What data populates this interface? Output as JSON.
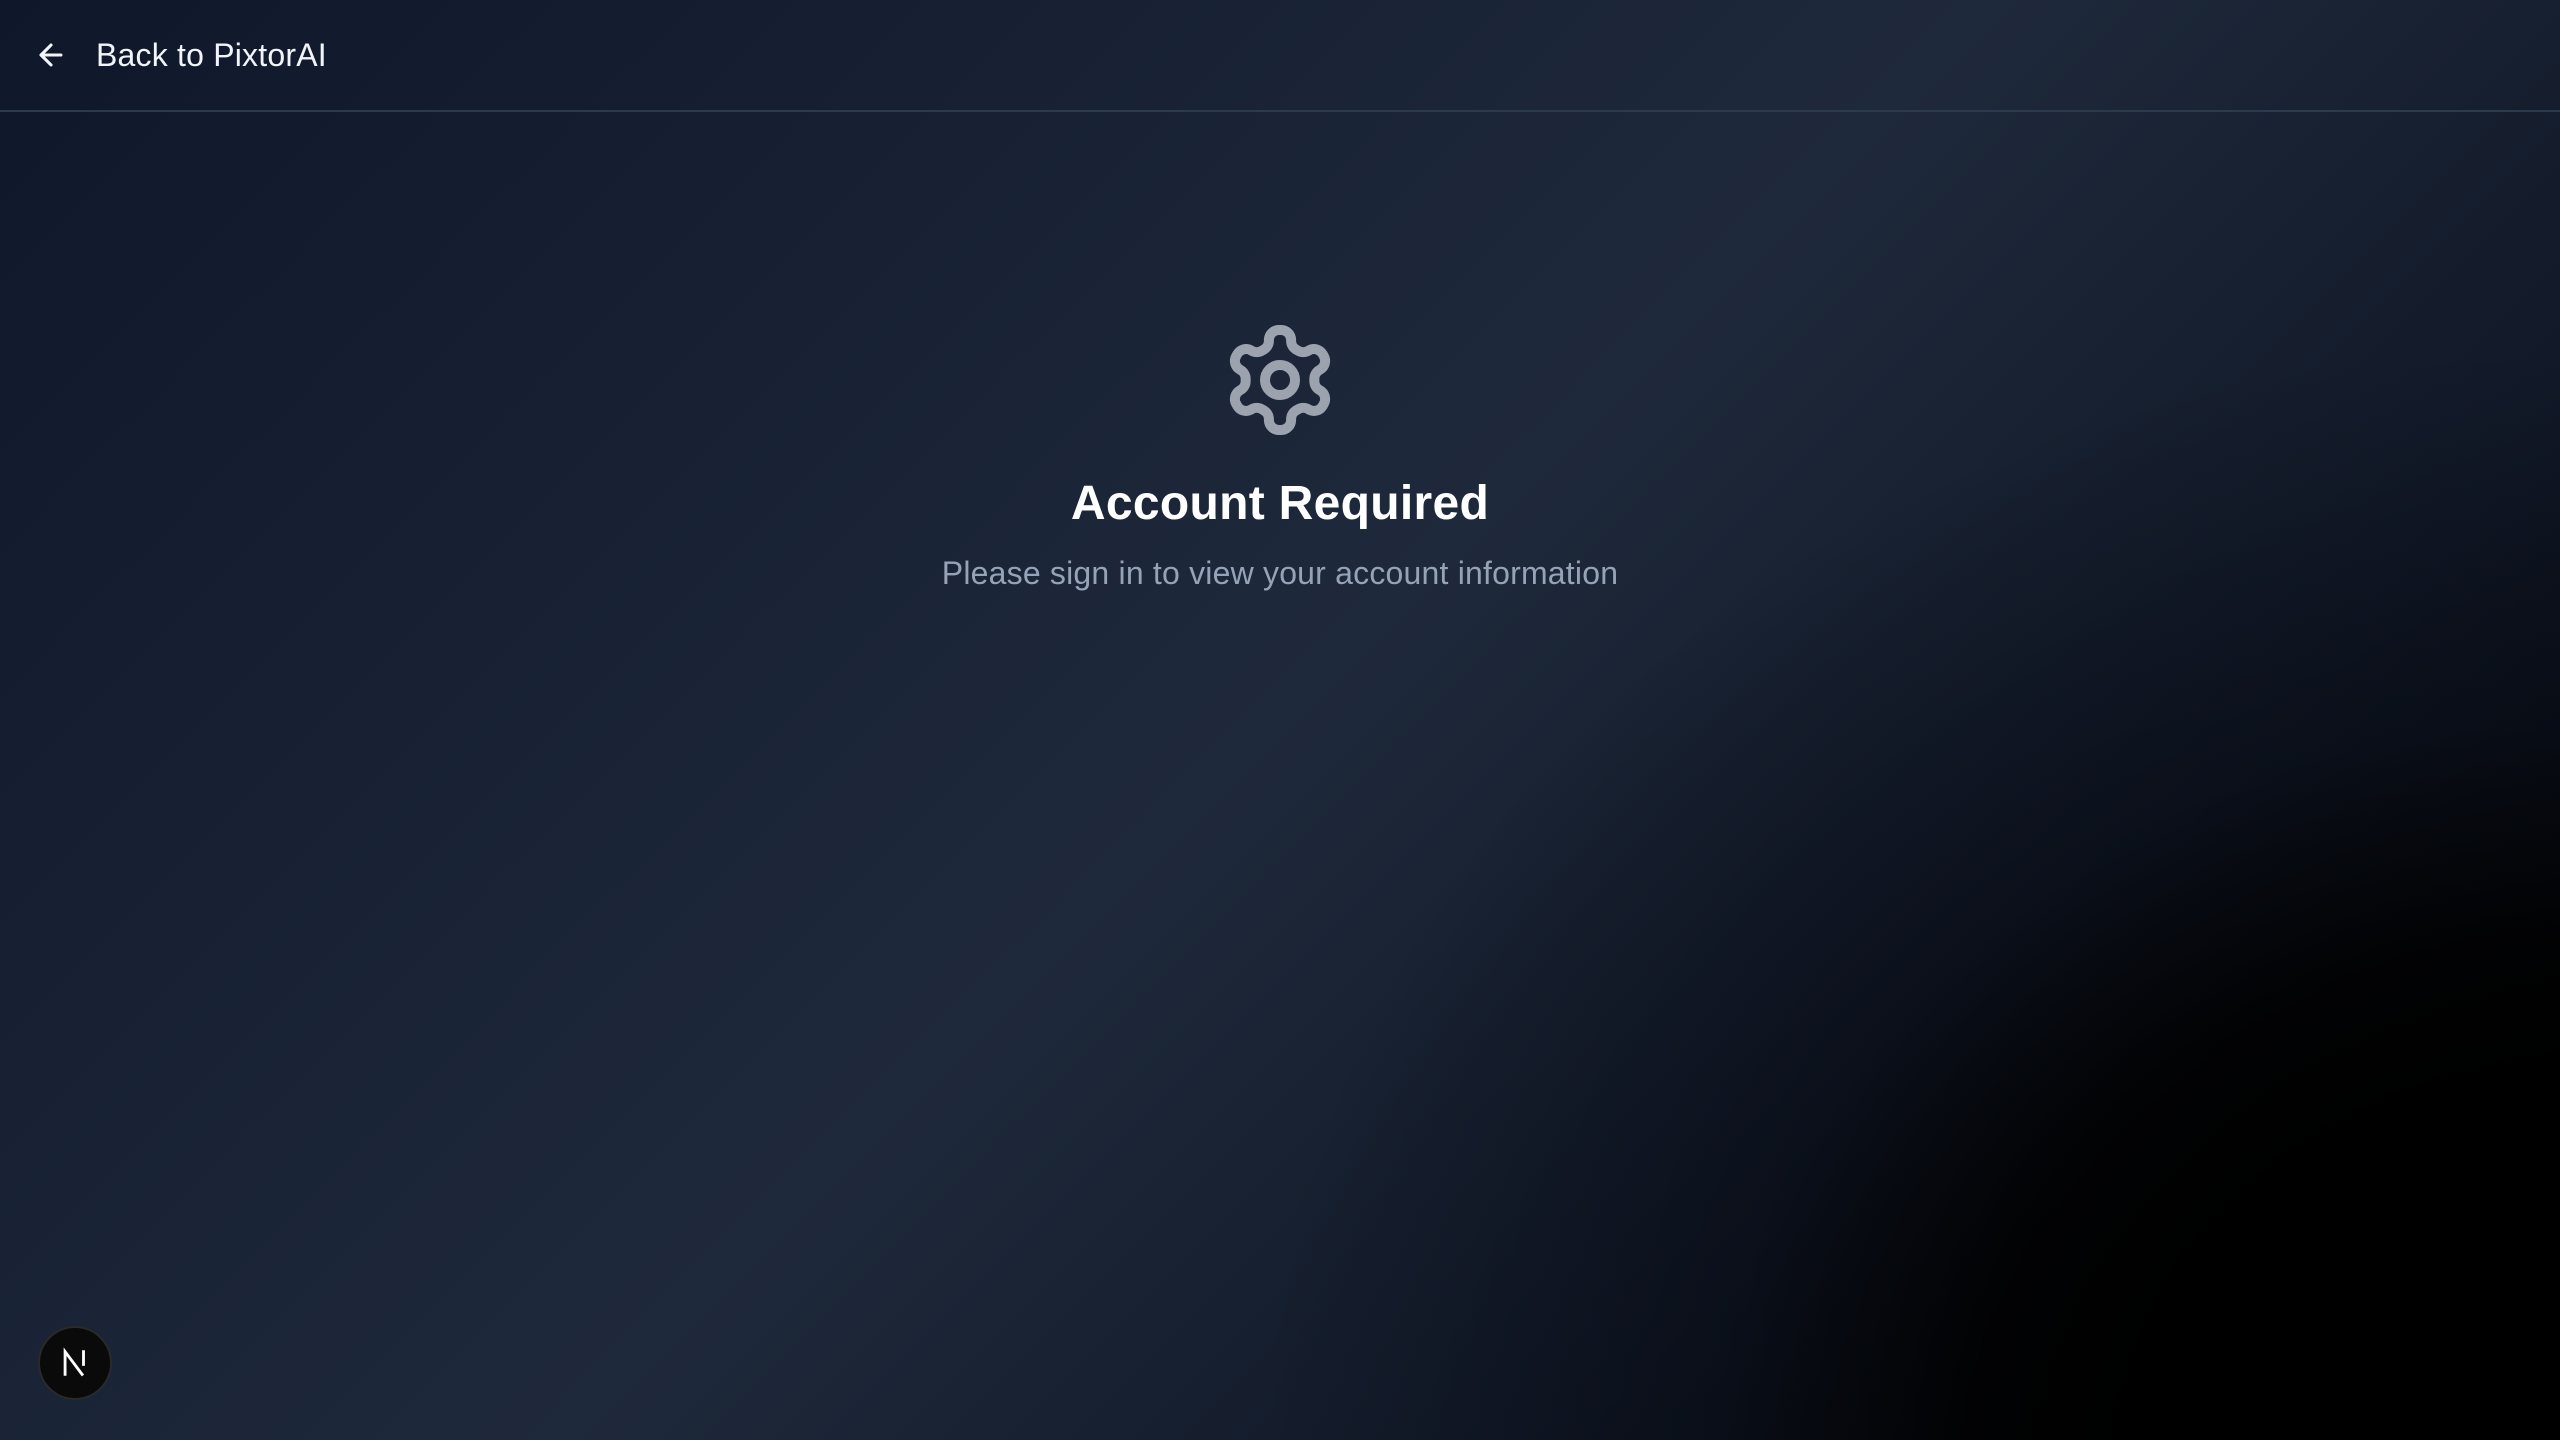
{
  "header": {
    "back_label": "Back to PixtorAI",
    "back_icon": "arrow-left-icon"
  },
  "main": {
    "icon": "gear-icon",
    "title": "Account Required",
    "subtitle": "Please sign in to view your account information"
  },
  "dev_badge": {
    "icon": "nextjs-n-icon"
  },
  "colors": {
    "background_start": "#0f172a",
    "background_mid": "#1e293b",
    "background_end": "#000000",
    "icon_gray": "#9ca3af",
    "subtitle_gray": "#94a3b8",
    "divider": "#2c3a4d"
  }
}
